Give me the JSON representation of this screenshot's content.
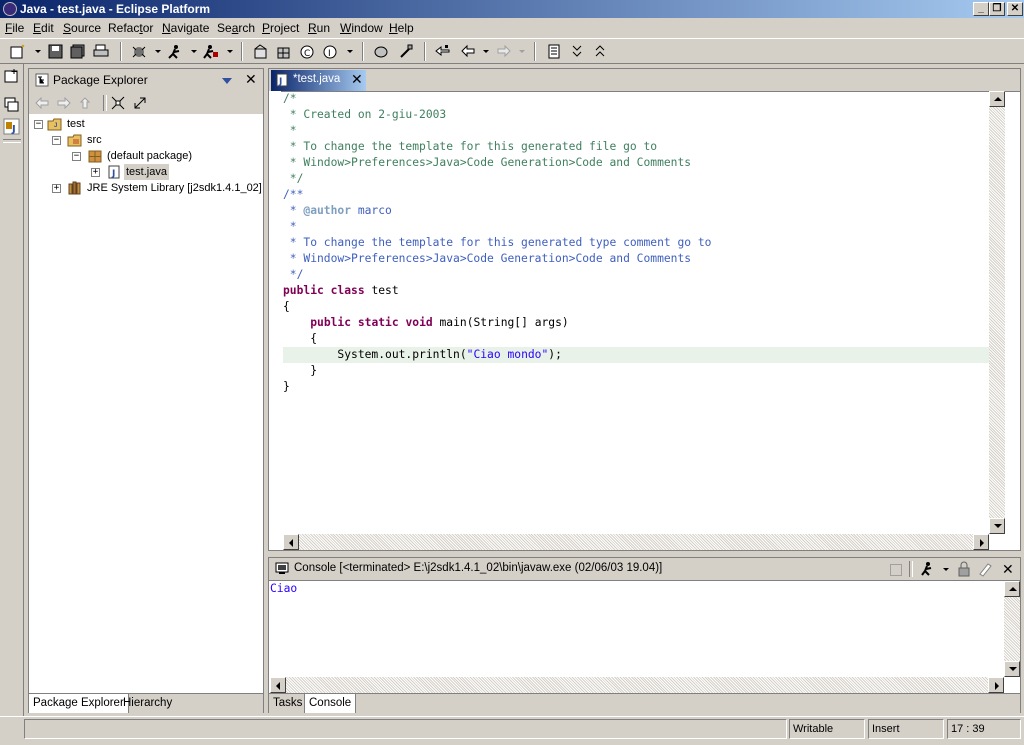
{
  "window": {
    "title": "Java - test.java - Eclipse Platform",
    "minimize": "_",
    "maximize": "❐",
    "close": "✕"
  },
  "menu": [
    {
      "label": "File",
      "mn": "F",
      "rest": "ile"
    },
    {
      "label": "Edit",
      "mn": "E",
      "rest": "dit"
    },
    {
      "label": "Source",
      "mn": "S",
      "rest": "ource"
    },
    {
      "label": "Refactor",
      "pre": "Refac",
      "mn": "t",
      "rest": "or"
    },
    {
      "label": "Navigate",
      "mn": "N",
      "rest": "avigate"
    },
    {
      "label": "Search",
      "pre": "Se",
      "mn": "a",
      "rest": "rch"
    },
    {
      "label": "Project",
      "mn": "P",
      "rest": "roject"
    },
    {
      "label": "Run",
      "mn": "R",
      "rest": "un"
    },
    {
      "label": "Window",
      "mn": "W",
      "rest": "indow"
    },
    {
      "label": "Help",
      "mn": "H",
      "rest": "elp"
    }
  ],
  "package_explorer": {
    "title": "Package Explorer",
    "tree": [
      {
        "label": "test",
        "expander": "−",
        "icon": "project-folder-icon"
      },
      {
        "label": "src",
        "expander": "−",
        "icon": "source-folder-icon"
      },
      {
        "label": "(default package)",
        "expander": "−",
        "icon": "package-icon"
      },
      {
        "label": "test.java",
        "expander": "+",
        "icon": "java-file-icon"
      },
      {
        "label": "JRE System Library [j2sdk1.4.1_02]",
        "expander": "+",
        "icon": "library-icon"
      }
    ],
    "bottom_tabs": [
      "Package Explorer",
      "Hierarchy"
    ]
  },
  "editor": {
    "tab_label": "*test.java",
    "current_line": "System.out.println(\"Ciao mondo\");",
    "string_literal": "\"Ciao mondo\"",
    "lines": [
      "/*",
      " * Created on 2-giu-2003",
      " *",
      " * To change the template for this generated file go to",
      " * Window>Preferences>Java>Code Generation>Code and Comments",
      " */",
      "/**",
      " * @author marco",
      " *",
      " * To change the template for this generated type comment go to",
      " * Window>Preferences>Java>Code Generation>Code and Comments",
      " */",
      "public class test",
      "{",
      "    public static void main(String[] args)",
      "    {",
      "        System.out.println(\"Ciao mondo\");",
      "    }",
      "}"
    ],
    "tokens": {
      "author_tag": "@author",
      "author_name": " marco",
      "public": "public",
      "class": "class",
      "static": "static",
      "void": "void",
      "class_name": " test",
      "main_sig": " main(String[] args)",
      "println_prefix": "System.out.println(",
      "println_suffix": ");"
    }
  },
  "console": {
    "title": "Console [<terminated> E:\\j2sdk1.4.1_02\\bin\\javaw.exe (02/06/03 19.04)]",
    "output": "Ciao",
    "bottom_tabs": [
      "Tasks",
      "Console"
    ]
  },
  "status": {
    "writable": "Writable",
    "insert": "Insert",
    "position": "17 : 39"
  },
  "colors": {
    "comment": "#3f7f5f",
    "keyword": "#7f0055",
    "string": "#2a00ff",
    "javadoc": "#3f5fbf",
    "title_bar_start": "#0a246a",
    "title_bar_end": "#a6caf0"
  }
}
